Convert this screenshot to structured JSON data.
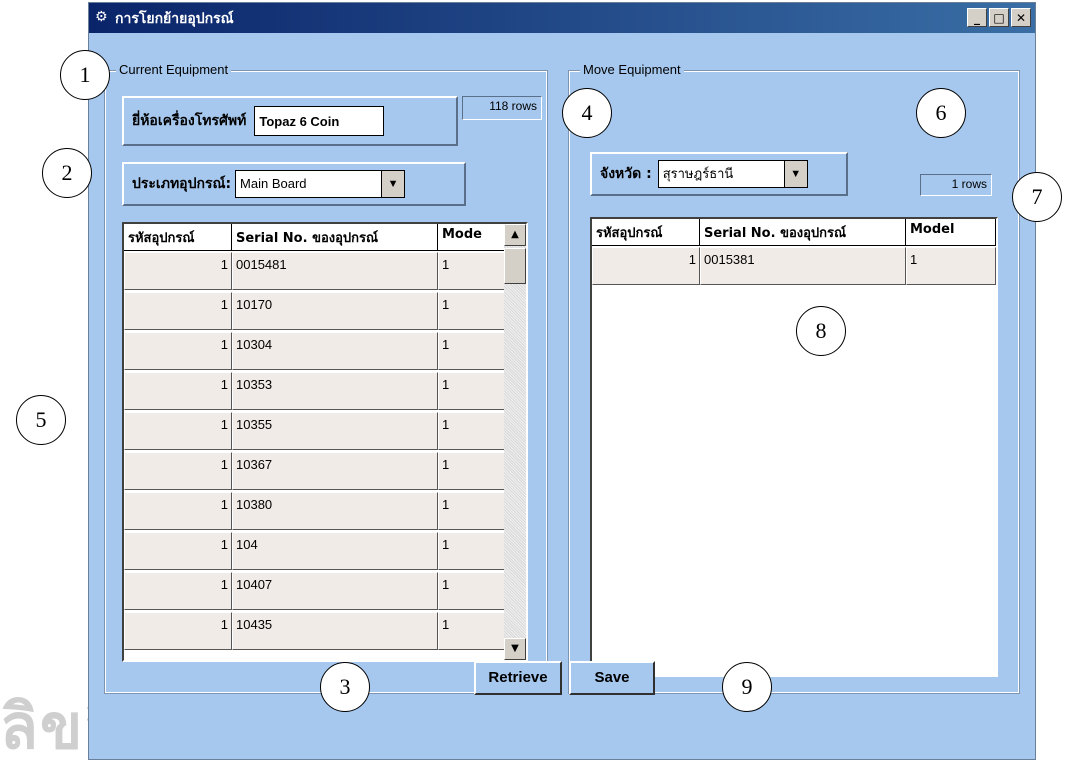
{
  "window": {
    "title": "การโยกย้ายอุปกรณ์",
    "controls": [
      "_",
      "□",
      "✕"
    ]
  },
  "current_group": {
    "title": "Current Equipment",
    "brand_label": "ยี่ห้อเครื่องโทรศัพท์",
    "brand_value": "Topaz 6 Coin",
    "rows_count": "118 rows",
    "type_label": "ประเภทอุปกรณ์:",
    "type_value": "Main Board",
    "columns": [
      "รหัสอุปกรณ์",
      "Serial No. ของอุปกรณ์",
      "Mode"
    ],
    "rows": [
      {
        "id": "1",
        "serial": "0015481",
        "model": "1"
      },
      {
        "id": "1",
        "serial": "10170",
        "model": "1"
      },
      {
        "id": "1",
        "serial": "10304",
        "model": "1"
      },
      {
        "id": "1",
        "serial": "10353",
        "model": "1"
      },
      {
        "id": "1",
        "serial": "10355",
        "model": "1"
      },
      {
        "id": "1",
        "serial": "10367",
        "model": "1"
      },
      {
        "id": "1",
        "serial": "10380",
        "model": "1"
      },
      {
        "id": "1",
        "serial": "104",
        "model": "1"
      },
      {
        "id": "1",
        "serial": "10407",
        "model": "1"
      },
      {
        "id": "1",
        "serial": "10435",
        "model": "1"
      }
    ]
  },
  "move_group": {
    "title": "Move Equipment",
    "province_label": "จังหวัด :",
    "province_value": "สุราษฎร์ธานี",
    "rows_count": "1 rows",
    "columns": [
      "รหัสอุปกรณ์",
      "Serial No. ของอุปกรณ์",
      "Model"
    ],
    "rows": [
      {
        "id": "1",
        "serial": "0015381",
        "model": "1"
      }
    ]
  },
  "buttons": {
    "retrieve": "Retrieve",
    "save": "Save"
  },
  "callouts": [
    "1",
    "2",
    "3",
    "4",
    "5",
    "6",
    "7",
    "8",
    "9"
  ],
  "watermark_text": "ลิขสิทธิ์มหาวิทยาลัยเชียงใหม่"
}
